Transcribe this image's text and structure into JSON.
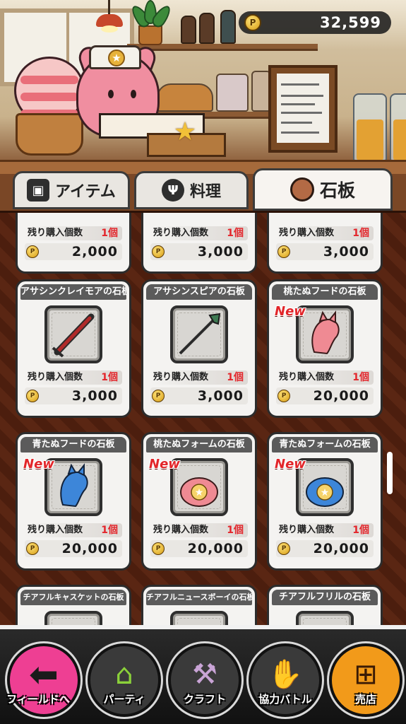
{
  "header": {
    "coins": "32,599",
    "coin_icon": "coin-icon"
  },
  "tabs": [
    {
      "label": "アイテム",
      "icon": "box-icon",
      "active": false
    },
    {
      "label": "料理",
      "icon": "fork-icon",
      "active": false
    },
    {
      "label": "石板",
      "icon": "slate-icon",
      "active": true
    }
  ],
  "shop": {
    "stock_label": "残り購入個数",
    "items": [
      {
        "name": "",
        "stock": "1個",
        "price": "2,000",
        "new": false
      },
      {
        "name": "",
        "stock": "1個",
        "price": "3,000",
        "new": false
      },
      {
        "name": "",
        "stock": "1個",
        "price": "3,000",
        "new": false
      },
      {
        "name": "アサシンクレイモアの石板",
        "stock": "1個",
        "price": "3,000",
        "new": false
      },
      {
        "name": "アサシンスピアの石板",
        "stock": "1個",
        "price": "3,000",
        "new": false
      },
      {
        "name": "桃たぬフードの石板",
        "stock": "1個",
        "price": "20,000",
        "new": true
      },
      {
        "name": "青たぬフードの石板",
        "stock": "1個",
        "price": "20,000",
        "new": true
      },
      {
        "name": "桃たぬフォームの石板",
        "stock": "1個",
        "price": "20,000",
        "new": true
      },
      {
        "name": "青たぬフォームの石板",
        "stock": "1個",
        "price": "20,000",
        "new": true
      },
      {
        "name": "チアフルキャスケットの石板",
        "new": false
      },
      {
        "name": "チアフルニュースボーイの石板",
        "new": false
      },
      {
        "name": "チアフルフリルの石板",
        "new": false
      }
    ],
    "new_badge": "New"
  },
  "nav": [
    {
      "label": "フィールドへ",
      "icon": "back-arrow-icon",
      "color": "#ee3f93"
    },
    {
      "label": "パーティ",
      "icon": "party-house-icon",
      "color": "#3a3a3a"
    },
    {
      "label": "クラフト",
      "icon": "hammer-icon",
      "color": "#3a3a3a"
    },
    {
      "label": "協力バトル",
      "icon": "handshake-icon",
      "color": "#3a3a3a"
    },
    {
      "label": "売店",
      "icon": "shop-cart-icon",
      "color": "#f29a1a"
    }
  ]
}
